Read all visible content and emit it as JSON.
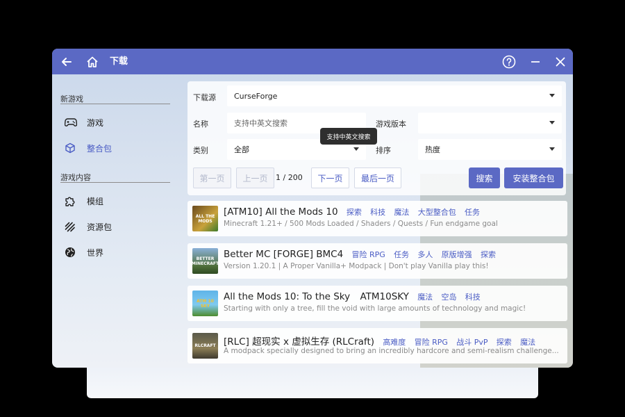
{
  "titlebar": {
    "title": "下载",
    "bg_color": "#5b69c4"
  },
  "sidebar": {
    "sections": [
      {
        "title": "新游戏",
        "items": [
          {
            "label": "游戏",
            "icon": "gamepad-icon",
            "active": false
          },
          {
            "label": "整合包",
            "icon": "cube-icon",
            "active": true
          }
        ]
      },
      {
        "title": "游戏内容",
        "items": [
          {
            "label": "模组",
            "icon": "puzzle-icon",
            "active": false
          },
          {
            "label": "资源包",
            "icon": "resourcepack-icon",
            "active": false
          },
          {
            "label": "世界",
            "icon": "globe-icon",
            "active": false
          }
        ]
      }
    ]
  },
  "search_panel": {
    "source_label": "下载源",
    "source_value": "CurseForge",
    "name_label": "名称",
    "name_placeholder": "支持中英文搜索",
    "version_label": "游戏版本",
    "version_value": "",
    "category_label": "类别",
    "category_value": "全部",
    "sort_label": "排序",
    "sort_value": "热度",
    "tooltip": "支持中英文搜索",
    "pagination": {
      "first": "第一页",
      "prev": "上一页",
      "info": "1 / 200",
      "next": "下一页",
      "last": "最后一页"
    },
    "search_button": "搜索",
    "install_button": "安装整合包"
  },
  "results": [
    {
      "title": "[ATM10] All the Mods 10",
      "tags": [
        "探索",
        "科技",
        "魔法",
        "大型整合包",
        "任务"
      ],
      "desc": "Minecraft 1.21+ / 500 Mods Loaded / Shaders / Quests / Fun endgame goal",
      "thumb_text": "ALL THE MODS"
    },
    {
      "title": "Better MC [FORGE] BMC4",
      "tags": [
        "冒险 RPG",
        "任务",
        "多人",
        "原版增强",
        "探索"
      ],
      "desc": "Version 1.20.1 | A Proper Vanilla+ Modpack | Don't play Vanilla play this!",
      "thumb_text": "BETTER MINECRAFT"
    },
    {
      "title": "All the Mods 10: To the Sky",
      "tags": [
        "ATM10SKY",
        "魔法",
        "空岛",
        "科技"
      ],
      "desc": "Starting with only a tree, fill the void with large amounts of technology and magic!",
      "thumb_text": "ATM 10 SKY"
    },
    {
      "title": "[RLC] 超现实 x 虚拟生存 (RLCraft)",
      "tags": [
        "高难度",
        "冒险 RPG",
        "战斗 PvP",
        "探索",
        "魔法"
      ],
      "desc": "A modpack specially designed to bring an incredibly hardcore and semi-realism challenge...",
      "thumb_text": "RLCRAFT"
    }
  ]
}
